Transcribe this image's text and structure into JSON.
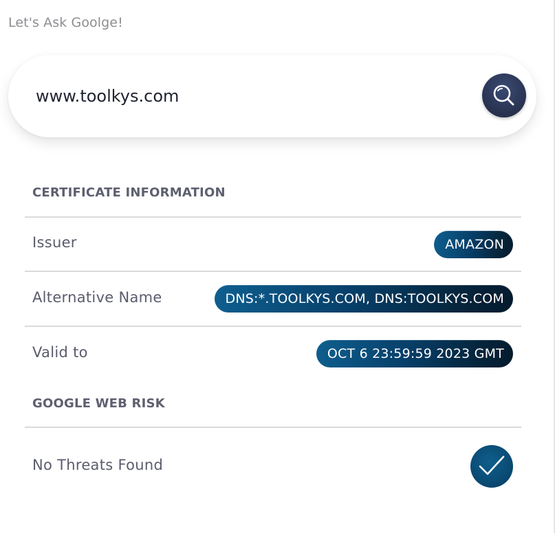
{
  "tagline": "Let's Ask Goolge!",
  "search": {
    "value": "www.toolkys.com",
    "icon": "search-icon"
  },
  "certificate": {
    "title": "CERTIFICATE INFORMATION",
    "rows": [
      {
        "label": "Issuer",
        "value": "AMAZON"
      },
      {
        "label": "Alternative Name",
        "value": "DNS:*.TOOLKYS.COM, DNS:TOOLKYS.COM"
      },
      {
        "label": "Valid to",
        "value": "OCT 6 23:59:59 2023 GMT"
      }
    ]
  },
  "web_risk": {
    "title": "GOOGLE WEB RISK",
    "status": "No Threats Found",
    "icon": "check-icon"
  },
  "colors": {
    "accent_dark": "#28324f",
    "pill_blue": "#07406a",
    "check_blue": "#0a4b74"
  }
}
